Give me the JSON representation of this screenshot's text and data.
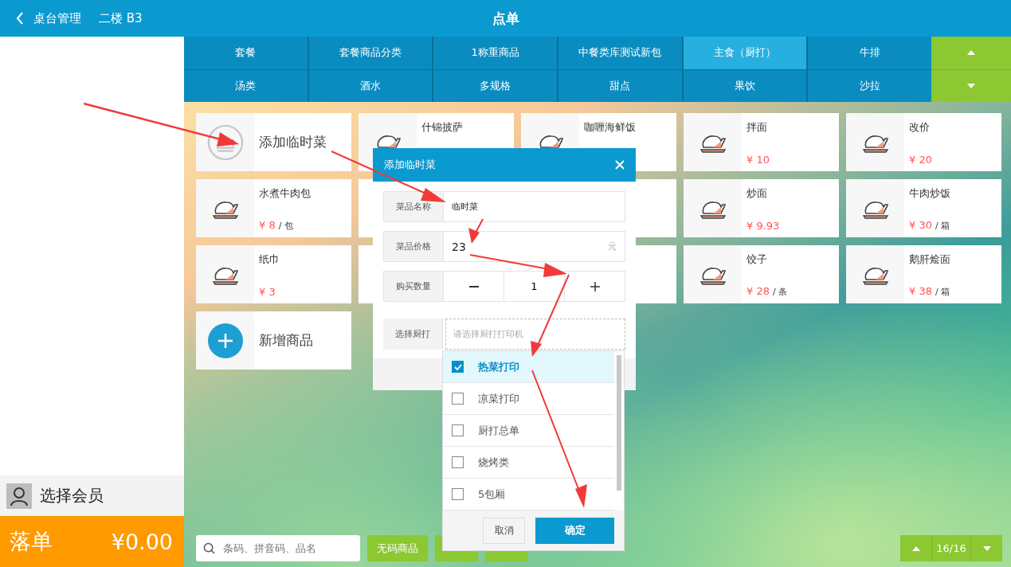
{
  "header": {
    "back_label": "桌台管理",
    "table_label": "二楼 B3",
    "title": "点单"
  },
  "categories": [
    {
      "label": "套餐",
      "selected": false
    },
    {
      "label": "套餐商品分类",
      "selected": false
    },
    {
      "label": "1称重商品",
      "selected": false
    },
    {
      "label": "中餐类库测试新包",
      "selected": false
    },
    {
      "label": "主食（厨打）",
      "selected": true
    },
    {
      "label": "牛排",
      "selected": false
    },
    {
      "label": "汤类",
      "selected": false
    },
    {
      "label": "酒水",
      "selected": false
    },
    {
      "label": "多规格",
      "selected": false
    },
    {
      "label": "甜点",
      "selected": false
    },
    {
      "label": "果饮",
      "selected": false
    },
    {
      "label": "沙拉",
      "selected": false
    }
  ],
  "products": [
    {
      "kind": "temp",
      "name": "添加临时菜"
    },
    {
      "kind": "dish",
      "name": "什锦披萨"
    },
    {
      "kind": "dish",
      "name": "咖喱海鲜饭"
    },
    {
      "kind": "dish",
      "name": "拌面",
      "price": "¥ 10"
    },
    {
      "kind": "dish",
      "name": "改价",
      "price": "¥ 20"
    },
    {
      "kind": "dish",
      "name": "水煮牛肉包",
      "price": "¥ 8",
      "unit": "/ 包"
    },
    {
      "kind": "covered"
    },
    {
      "kind": "covered"
    },
    {
      "kind": "dish",
      "name": "炒面",
      "price": "¥ 9.93"
    },
    {
      "kind": "dish",
      "name": "牛肉炒饭",
      "price": "¥ 30",
      "unit": "/ 箱"
    },
    {
      "kind": "dish",
      "name": "纸巾",
      "price": "¥ 3"
    },
    {
      "kind": "covered"
    },
    {
      "kind": "covered"
    },
    {
      "kind": "dish",
      "name": "饺子",
      "price": "¥ 28",
      "unit": "/ 条"
    },
    {
      "kind": "dish",
      "name": "鹅肝烩面",
      "price": "¥ 38",
      "unit": "/ 箱"
    },
    {
      "kind": "new",
      "name": "新增商品"
    }
  ],
  "member": {
    "label": "选择会员"
  },
  "checkout": {
    "label": "落单",
    "total": "¥0.00"
  },
  "search": {
    "placeholder": "条码、拼音码、品名"
  },
  "toolbar_buttons": [
    {
      "kind": "labeled",
      "label": "无码商品"
    },
    {
      "kind": "covered"
    },
    {
      "kind": "covered"
    }
  ],
  "pager": {
    "text": "16/16"
  },
  "modal": {
    "title": "添加临时菜",
    "name": {
      "label": "菜品名称",
      "value": "临时菜"
    },
    "price": {
      "label": "菜品价格",
      "value": "23",
      "unit": "元"
    },
    "quantity": {
      "label": "购买数量",
      "value": "1"
    },
    "printer": {
      "label": "选择厨打",
      "placeholder": "请选择厨打打印机"
    }
  },
  "printer_options": [
    {
      "label": "热菜打印",
      "checked": true
    },
    {
      "label": "凉菜打印",
      "checked": false
    },
    {
      "label": "厨打总单",
      "checked": false
    },
    {
      "label": "烧烤类",
      "checked": false
    },
    {
      "label": "5包厢",
      "checked": false
    }
  ],
  "dropdown_buttons": {
    "cancel": "取消",
    "confirm": "确定"
  }
}
